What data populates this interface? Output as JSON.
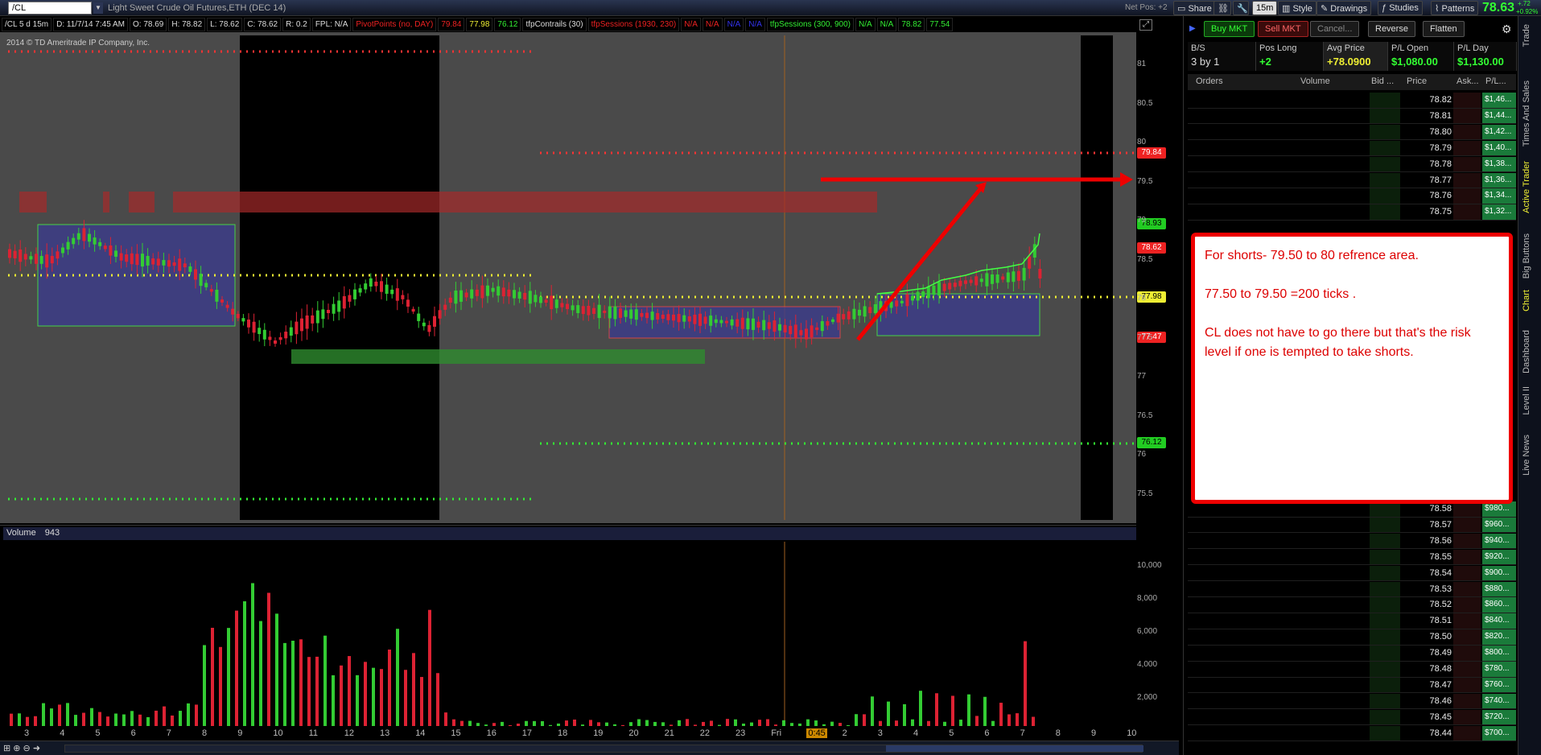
{
  "topbar": {
    "symbol": "/CL",
    "title": "Light Sweet Crude Oil Futures,ETH (DEC 14)",
    "netpos": "Net Pos: +2",
    "share": "Share",
    "timeframe": "15m",
    "style": "Style",
    "drawings": "Drawings",
    "studies": "Studies",
    "patterns": "Patterns",
    "last_price": "78.63",
    "change": "+.72",
    "change_pct": "+0.92%"
  },
  "header": {
    "symbol_period": "/CL 5 d 15m",
    "date": "D: 11/7/14 7:45 AM",
    "open": "O: 78.69",
    "high": "H: 78.82",
    "low": "L: 78.62",
    "close": "C: 78.62",
    "range": "R: 0.2",
    "fpl": "FPL: N/A",
    "pivot": "PivotPoints (no, DAY)",
    "pivot_v1": "79.84",
    "pivot_v2": "77.98",
    "pivot_v3": "76.12",
    "contrails": "tfpContrails (30)",
    "sessions1": "tfpSessions (1930, 230)",
    "na": "N/A",
    "sessions2": "tfpSessions (300, 900)",
    "v_a": "78.82",
    "v_b": "77.54"
  },
  "chart": {
    "copyright": "2014 © TD Ameritrade IP Company, Inc.",
    "yaxis": [
      "81",
      "80.5",
      "80",
      "79.5",
      "79",
      "78.5",
      "78",
      "77.5",
      "77",
      "76.5",
      "76",
      "75.5"
    ],
    "tags": {
      "r1": "79.84",
      "g1": "78.93",
      "last": "78.62",
      "pp": "77.98",
      "s": "77.47",
      "s1": "76.12"
    }
  },
  "volume": {
    "label": "Volume",
    "value": "943",
    "yaxis": [
      "10,000",
      "8,000",
      "6,000",
      "4,000",
      "2,000"
    ]
  },
  "xaxis": [
    "3",
    "4",
    "5",
    "6",
    "7",
    "8",
    "9",
    "10",
    "11",
    "12",
    "13",
    "14",
    "15",
    "16",
    "17",
    "18",
    "19",
    "20",
    "21",
    "22",
    "23",
    "Fri",
    "0:45",
    "2",
    "3",
    "4",
    "5",
    "6",
    "7",
    "8",
    "9",
    "10"
  ],
  "trade": {
    "buy": "Buy MKT",
    "sell": "Sell MKT",
    "cancel": "Cancel...",
    "reverse": "Reverse",
    "flatten": "Flatten"
  },
  "stats": {
    "bs_label": "B/S",
    "bs_val": "3 by 1",
    "pos_label": "Pos Long",
    "pos_val": "+2",
    "avg_label": "Avg Price",
    "avg_val": "+78.0900",
    "plo_label": "P/L Open",
    "plo_val": "$1,080.00",
    "pld_label": "P/L Day",
    "pld_val": "$1,130.00"
  },
  "ladder": {
    "headers": {
      "orders": "Orders",
      "volume": "Volume",
      "bid": "Bid ...",
      "price": "Price",
      "ask": "Ask...",
      "pl": "P/L..."
    },
    "rows_top": [
      {
        "price": "78.82",
        "pl": "$1,46..."
      },
      {
        "price": "78.81",
        "pl": "$1,44..."
      },
      {
        "price": "78.80",
        "pl": "$1,42..."
      },
      {
        "price": "78.79",
        "pl": "$1,40..."
      },
      {
        "price": "78.78",
        "pl": "$1,38..."
      },
      {
        "price": "78.77",
        "pl": "$1,36..."
      },
      {
        "price": "78.76",
        "pl": "$1,34..."
      },
      {
        "price": "78.75",
        "pl": "$1,32..."
      }
    ],
    "rows_bottom": [
      {
        "price": "78.58",
        "pl": "$980..."
      },
      {
        "price": "78.57",
        "pl": "$960..."
      },
      {
        "price": "78.56",
        "pl": "$940..."
      },
      {
        "price": "78.55",
        "pl": "$920..."
      },
      {
        "price": "78.54",
        "pl": "$900..."
      },
      {
        "price": "78.53",
        "pl": "$880..."
      },
      {
        "price": "78.52",
        "pl": "$860..."
      },
      {
        "price": "78.51",
        "pl": "$840..."
      },
      {
        "price": "78.50",
        "pl": "$820..."
      },
      {
        "price": "78.49",
        "pl": "$800..."
      },
      {
        "price": "78.48",
        "pl": "$780..."
      },
      {
        "price": "78.47",
        "pl": "$760..."
      },
      {
        "price": "78.46",
        "pl": "$740..."
      },
      {
        "price": "78.45",
        "pl": "$720..."
      },
      {
        "price": "78.44",
        "pl": "$700..."
      }
    ]
  },
  "side_tabs": [
    "Trade",
    "Times And Sales",
    "Active Trader",
    "Big Buttons",
    "Chart",
    "Dashboard",
    "Level II",
    "Live News"
  ],
  "note": {
    "line1": "For shorts- 79.50 to 80 refrence area.",
    "line2": "77.50 to 79.50 =200 ticks .",
    "line3": "CL does not have to go there but that's the risk level if one is tempted to take shorts."
  }
}
